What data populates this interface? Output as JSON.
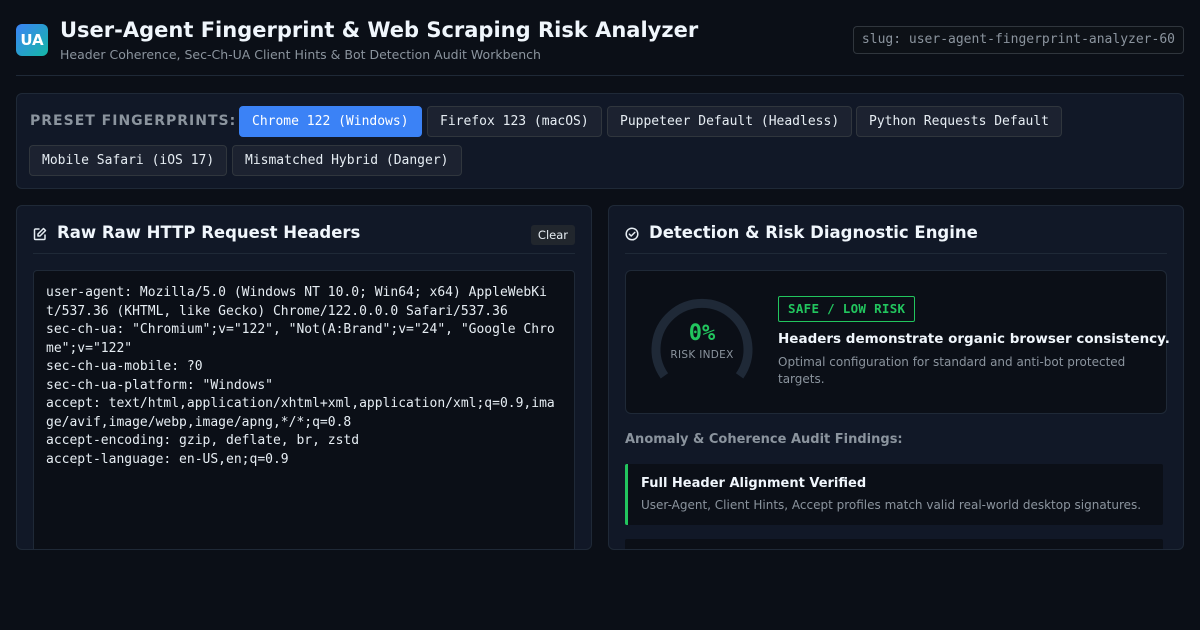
{
  "app": {
    "logo": "UA",
    "title": "User-Agent Fingerprint & Web Scraping Risk Analyzer",
    "subtitle": "Header Coherence, Sec-Ch-UA Client Hints & Bot Detection Audit Workbench",
    "slug": "slug: user-agent-fingerprint-analyzer-60"
  },
  "presets": {
    "label": "PRESET FINGERPRINTS:",
    "items": [
      {
        "label": "Chrome 122 (Windows)",
        "active": true
      },
      {
        "label": "Firefox 123 (macOS)",
        "active": false
      },
      {
        "label": "Puppeteer Default (Headless)",
        "active": false
      },
      {
        "label": "Python Requests Default",
        "active": false
      },
      {
        "label": "Mobile Safari (iOS 17)",
        "active": false
      },
      {
        "label": "Mismatched Hybrid (Danger)",
        "active": false
      }
    ]
  },
  "headers_panel": {
    "icon": "edit-icon",
    "title": "Raw Raw HTTP Request Headers",
    "clear_label": "Clear",
    "raw_headers": "user-agent: Mozilla/5.0 (Windows NT 10.0; Win64; x64) AppleWebKit/537.36 (KHTML, like Gecko) Chrome/122.0.0.0 Safari/537.36\nsec-ch-ua: \"Chromium\";v=\"122\", \"Not(A:Brand\";v=\"24\", \"Google Chrome\";v=\"122\"\nsec-ch-ua-mobile: ?0\nsec-ch-ua-platform: \"Windows\"\naccept: text/html,application/xhtml+xml,application/xml;q=0.9,image/avif,image/webp,image/apng,*/*;q=0.8\naccept-encoding: gzip, deflate, br, zstd\naccept-language: en-US,en;q=0.9"
  },
  "diagnostic_panel": {
    "icon": "check-circle-icon",
    "title": "Detection & Risk Diagnostic Engine",
    "risk": {
      "value": "0%",
      "percent": 0,
      "label": "RISK INDEX",
      "badge": "SAFE / LOW RISK",
      "headline": "Headers demonstrate organic browser consistency.",
      "description": "Optimal configuration for standard and anti-bot protected targets."
    },
    "findings_label": "Anomaly & Coherence Audit Findings:",
    "findings": [
      {
        "title": "Full Header Alignment Verified",
        "description": "User-Agent, Client Hints, Accept profiles match valid real-world desktop signatures."
      }
    ]
  },
  "colors": {
    "accent": "#3b82f6",
    "safe": "#22c55e",
    "background": "#0b0f17",
    "panel": "#111827"
  }
}
